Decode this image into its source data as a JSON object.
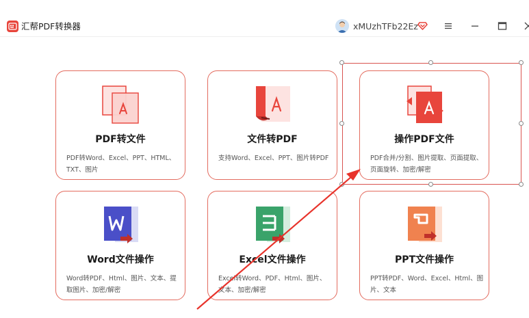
{
  "app": {
    "title": "汇帮PDF转换器",
    "username": "xMUzhTFb22Ez"
  },
  "colors": {
    "accent": "#e8453c",
    "card_border": "#e36b5e",
    "word_blue": "#4a4fc8",
    "excel_green": "#3aa36a",
    "ppt_orange": "#f0824f"
  },
  "icons": [
    "app-logo-icon",
    "avatar",
    "vip-diamond-icon",
    "menu-icon",
    "minimize-icon",
    "maximize-icon",
    "close-icon"
  ],
  "cards": [
    {
      "title": "PDF转文件",
      "desc": "PDF转Word、Excel、PPT、HTML、TXT、图片",
      "icon": "pdf-to-file-icon"
    },
    {
      "title": "文件转PDF",
      "desc": "支持Word、Excel、PPT、图片转PDF",
      "icon": "file-to-pdf-icon"
    },
    {
      "title": "操作PDF文件",
      "desc": "PDF合并/分割、图片提取、页面提取、页面旋转、加密/解密",
      "icon": "pdf-operation-icon"
    },
    {
      "title": "Word文件操作",
      "desc": "Word转PDF、Html、图片、文本、提取图片、加密/解密",
      "icon": "word-icon"
    },
    {
      "title": "Excel文件操作",
      "desc": "Excel转Word、PDF、Html、图片、文本、加密/解密",
      "icon": "excel-icon"
    },
    {
      "title": "PPT文件操作",
      "desc": "PPT转PDF、Word、Excel、Html、图片、文本",
      "icon": "ppt-icon"
    }
  ]
}
